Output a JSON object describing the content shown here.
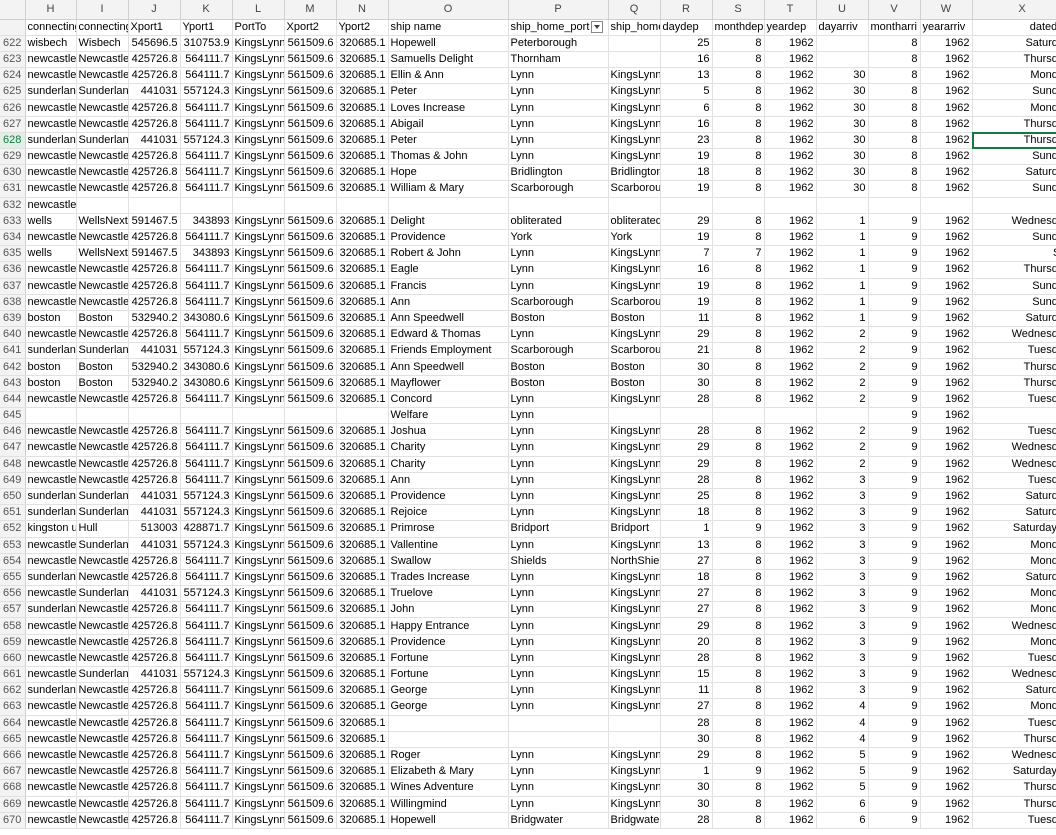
{
  "columns": [
    "H",
    "I",
    "J",
    "K",
    "L",
    "M",
    "N",
    "O",
    "P",
    "Q",
    "R",
    "S",
    "T",
    "U",
    "V",
    "W",
    "X"
  ],
  "selected_row": "628",
  "rows": [
    {
      "n": "",
      "c": [
        "connecting",
        "connecting",
        "Xport1",
        "Yport1",
        "PortTo",
        "Xport2",
        "Yport2",
        "ship name",
        "ship_home_port",
        "ship_home",
        "daydep",
        "monthdep",
        "yeardep",
        "dayarriv",
        "montharri",
        "yeararriv",
        "datedep"
      ],
      "h": true
    },
    {
      "n": "622",
      "c": [
        "wisbech",
        "Wisbech",
        "545696.5",
        "310753.9",
        "KingsLynn",
        "561509.6",
        "320685.1",
        "Hopewell",
        "Peterborough",
        "",
        "25",
        "8",
        "1962",
        "",
        "8",
        "1962",
        "Saturday"
      ]
    },
    {
      "n": "623",
      "c": [
        "newcastle",
        "Newcastle",
        "425726.8",
        "564111.7",
        "KingsLynn",
        "561509.6",
        "320685.1",
        "Samuells Delight",
        "Thornham",
        "",
        "16",
        "8",
        "1962",
        "",
        "8",
        "1962",
        "Thursday"
      ]
    },
    {
      "n": "624",
      "c": [
        "newcastle",
        "Newcastle",
        "425726.8",
        "564111.7",
        "KingsLynn",
        "561509.6",
        "320685.1",
        "Ellin & Ann",
        "Lynn",
        "KingsLynn",
        "13",
        "8",
        "1962",
        "30",
        "8",
        "1962",
        "Monday"
      ]
    },
    {
      "n": "625",
      "c": [
        "sunderland",
        "Sunderlan",
        "441031",
        "557124.3",
        "KingsLynn",
        "561509.6",
        "320685.1",
        "Peter",
        "Lynn",
        "KingsLynn",
        "5",
        "8",
        "1962",
        "30",
        "8",
        "1962",
        "Sunday"
      ]
    },
    {
      "n": "626",
      "c": [
        "newcastle",
        "Newcastle",
        "425726.8",
        "564111.7",
        "KingsLynn",
        "561509.6",
        "320685.1",
        "Loves Increase",
        "Lynn",
        "KingsLynn",
        "6",
        "8",
        "1962",
        "30",
        "8",
        "1962",
        "Monday"
      ]
    },
    {
      "n": "627",
      "c": [
        "newcastle",
        "Newcastle",
        "425726.8",
        "564111.7",
        "KingsLynn",
        "561509.6",
        "320685.1",
        "Abigail",
        "Lynn",
        "KingsLynn",
        "16",
        "8",
        "1962",
        "30",
        "8",
        "1962",
        "Thursday"
      ]
    },
    {
      "n": "628",
      "c": [
        "sunderland",
        "Sunderlan",
        "441031",
        "557124.3",
        "KingsLynn",
        "561509.6",
        "320685.1",
        "Peter",
        "Lynn",
        "KingsLynn",
        "23",
        "8",
        "1962",
        "30",
        "8",
        "1962",
        "Thursday"
      ],
      "sel": true
    },
    {
      "n": "629",
      "c": [
        "newcastle",
        "Newcastle",
        "425726.8",
        "564111.7",
        "KingsLynn",
        "561509.6",
        "320685.1",
        "Thomas & John",
        "Lynn",
        "KingsLynn",
        "19",
        "8",
        "1962",
        "30",
        "8",
        "1962",
        "Sunday"
      ]
    },
    {
      "n": "630",
      "c": [
        "newcastle",
        "Newcastle",
        "425726.8",
        "564111.7",
        "KingsLynn",
        "561509.6",
        "320685.1",
        "Hope",
        "Bridlington",
        "Bridlington",
        "18",
        "8",
        "1962",
        "30",
        "8",
        "1962",
        "Saturday"
      ]
    },
    {
      "n": "631",
      "c": [
        "newcastle",
        "Newcastle",
        "425726.8",
        "564111.7",
        "KingsLynn",
        "561509.6",
        "320685.1",
        "William & Mary",
        "Scarborough",
        "Scarborou",
        "19",
        "8",
        "1962",
        "30",
        "8",
        "1962",
        "Sunday"
      ]
    },
    {
      "n": "632",
      "c": [
        "newcastle",
        "",
        "",
        "",
        "",
        "",
        "",
        "",
        "",
        "",
        "",
        "",
        "",
        "",
        "",
        "",
        ""
      ]
    },
    {
      "n": "633",
      "c": [
        "wells",
        "WellsNext",
        "591467.5",
        "343893",
        "KingsLynn",
        "561509.6",
        "320685.1",
        "Delight",
        "obliterated",
        "obliterated",
        "29",
        "8",
        "1962",
        "1",
        "9",
        "1962",
        "Wednesday"
      ]
    },
    {
      "n": "634",
      "c": [
        "newcastle",
        "Newcastle",
        "425726.8",
        "564111.7",
        "KingsLynn",
        "561509.6",
        "320685.1",
        "Providence",
        "York",
        "York",
        "19",
        "8",
        "1962",
        "1",
        "9",
        "1962",
        "Sunday"
      ]
    },
    {
      "n": "635",
      "c": [
        "wells",
        "WellsNext",
        "591467.5",
        "343893",
        "KingsLynn",
        "561509.6",
        "320685.1",
        "Robert & John",
        "Lynn",
        "KingsLynn",
        "7",
        "7",
        "1962",
        "1",
        "9",
        "1962",
        "Sat"
      ]
    },
    {
      "n": "636",
      "c": [
        "newcastle",
        "Newcastle",
        "425726.8",
        "564111.7",
        "KingsLynn",
        "561509.6",
        "320685.1",
        "Eagle",
        "Lynn",
        "KingsLynn",
        "16",
        "8",
        "1962",
        "1",
        "9",
        "1962",
        "Thursday"
      ]
    },
    {
      "n": "637",
      "c": [
        "newcastle",
        "Newcastle",
        "425726.8",
        "564111.7",
        "KingsLynn",
        "561509.6",
        "320685.1",
        "Francis",
        "Lynn",
        "KingsLynn",
        "19",
        "8",
        "1962",
        "1",
        "9",
        "1962",
        "Sunday"
      ]
    },
    {
      "n": "638",
      "c": [
        "newcastle",
        "Newcastle",
        "425726.8",
        "564111.7",
        "KingsLynn",
        "561509.6",
        "320685.1",
        "Ann",
        "Scarborough",
        "Scarborou",
        "19",
        "8",
        "1962",
        "1",
        "9",
        "1962",
        "Sunday"
      ]
    },
    {
      "n": "639",
      "c": [
        "boston",
        "Boston",
        "532940.2",
        "343080.6",
        "KingsLynn",
        "561509.6",
        "320685.1",
        "Ann Speedwell",
        "Boston",
        "Boston",
        "11",
        "8",
        "1962",
        "1",
        "9",
        "1962",
        "Saturday"
      ]
    },
    {
      "n": "640",
      "c": [
        "newcastle",
        "Newcastle",
        "425726.8",
        "564111.7",
        "KingsLynn",
        "561509.6",
        "320685.1",
        "Edward & Thomas",
        "Lynn",
        "KingsLynn",
        "29",
        "8",
        "1962",
        "2",
        "9",
        "1962",
        "Wednesday"
      ]
    },
    {
      "n": "641",
      "c": [
        "sunderland",
        "Sunderlan",
        "441031",
        "557124.3",
        "KingsLynn",
        "561509.6",
        "320685.1",
        "Friends Employment",
        "Scarborough",
        "Scarborou",
        "21",
        "8",
        "1962",
        "2",
        "9",
        "1962",
        "Tuesday"
      ]
    },
    {
      "n": "642",
      "c": [
        "boston",
        "Boston",
        "532940.2",
        "343080.6",
        "KingsLynn",
        "561509.6",
        "320685.1",
        "Ann Speedwell",
        "Boston",
        "Boston",
        "30",
        "8",
        "1962",
        "2",
        "9",
        "1962",
        "Thursday"
      ]
    },
    {
      "n": "643",
      "c": [
        "boston",
        "Boston",
        "532940.2",
        "343080.6",
        "KingsLynn",
        "561509.6",
        "320685.1",
        "Mayflower",
        "Boston",
        "Boston",
        "30",
        "8",
        "1962",
        "2",
        "9",
        "1962",
        "Thursday"
      ]
    },
    {
      "n": "644",
      "c": [
        "newcastle",
        "Newcastle",
        "425726.8",
        "564111.7",
        "KingsLynn",
        "561509.6",
        "320685.1",
        "Concord",
        "Lynn",
        "KingsLynn",
        "28",
        "8",
        "1962",
        "2",
        "9",
        "1962",
        "Tuesday"
      ]
    },
    {
      "n": "645",
      "c": [
        "",
        "",
        "",
        "",
        "",
        "",
        "",
        "Welfare",
        "Lynn",
        "",
        "",
        "",
        "",
        "",
        "9",
        "1962",
        ""
      ]
    },
    {
      "n": "646",
      "c": [
        "newcastle",
        "Newcastle",
        "425726.8",
        "564111.7",
        "KingsLynn",
        "561509.6",
        "320685.1",
        "Joshua",
        "Lynn",
        "KingsLynn",
        "28",
        "8",
        "1962",
        "2",
        "9",
        "1962",
        "Tuesday"
      ]
    },
    {
      "n": "647",
      "c": [
        "newcastle",
        "Newcastle",
        "425726.8",
        "564111.7",
        "KingsLynn",
        "561509.6",
        "320685.1",
        "Charity",
        "Lynn",
        "KingsLynn",
        "29",
        "8",
        "1962",
        "2",
        "9",
        "1962",
        "Wednesday"
      ]
    },
    {
      "n": "648",
      "c": [
        "newcastle",
        "Newcastle",
        "425726.8",
        "564111.7",
        "KingsLynn",
        "561509.6",
        "320685.1",
        "Charity",
        "Lynn",
        "KingsLynn",
        "29",
        "8",
        "1962",
        "2",
        "9",
        "1962",
        "Wednesday"
      ]
    },
    {
      "n": "649",
      "c": [
        "newcastle",
        "Newcastle",
        "425726.8",
        "564111.7",
        "KingsLynn",
        "561509.6",
        "320685.1",
        "Ann",
        "Lynn",
        "KingsLynn",
        "28",
        "8",
        "1962",
        "3",
        "9",
        "1962",
        "Tuesday"
      ]
    },
    {
      "n": "650",
      "c": [
        "sunderland",
        "Sunderlan",
        "441031",
        "557124.3",
        "KingsLynn",
        "561509.6",
        "320685.1",
        "Providence",
        "Lynn",
        "KingsLynn",
        "25",
        "8",
        "1962",
        "3",
        "9",
        "1962",
        "Saturday"
      ]
    },
    {
      "n": "651",
      "c": [
        "sunderland",
        "Sunderlan",
        "441031",
        "557124.3",
        "KingsLynn",
        "561509.6",
        "320685.1",
        "Rejoice",
        "Lynn",
        "KingsLynn",
        "18",
        "8",
        "1962",
        "3",
        "9",
        "1962",
        "Saturday"
      ]
    },
    {
      "n": "652",
      "c": [
        "kingston u",
        "Hull",
        "513003",
        "428871.7",
        "KingsLynn",
        "561509.6",
        "320685.1",
        "Primrose",
        "Bridport",
        "Bridport",
        "1",
        "9",
        "1962",
        "3",
        "9",
        "1962",
        "Saturday, S"
      ]
    },
    {
      "n": "653",
      "c": [
        "newcastle",
        "Sunderlan",
        "441031",
        "557124.3",
        "KingsLynn",
        "561509.6",
        "320685.1",
        "Vallentine",
        "Lynn",
        "KingsLynn",
        "13",
        "8",
        "1962",
        "3",
        "9",
        "1962",
        "Monday"
      ]
    },
    {
      "n": "654",
      "c": [
        "newcastle",
        "Newcastle",
        "425726.8",
        "564111.7",
        "KingsLynn",
        "561509.6",
        "320685.1",
        "Swallow",
        "Shields",
        "NorthShie",
        "27",
        "8",
        "1962",
        "3",
        "9",
        "1962",
        "Monday"
      ]
    },
    {
      "n": "655",
      "c": [
        "sunderland",
        "Newcastle",
        "425726.8",
        "564111.7",
        "KingsLynn",
        "561509.6",
        "320685.1",
        "Trades Increase",
        "Lynn",
        "KingsLynn",
        "18",
        "8",
        "1962",
        "3",
        "9",
        "1962",
        "Saturday"
      ]
    },
    {
      "n": "656",
      "c": [
        "newcastle",
        "Sunderlan",
        "441031",
        "557124.3",
        "KingsLynn",
        "561509.6",
        "320685.1",
        "Truelove",
        "Lynn",
        "KingsLynn",
        "27",
        "8",
        "1962",
        "3",
        "9",
        "1962",
        "Monday"
      ]
    },
    {
      "n": "657",
      "c": [
        "sunderland",
        "Newcastle",
        "425726.8",
        "564111.7",
        "KingsLynn",
        "561509.6",
        "320685.1",
        "John",
        "Lynn",
        "KingsLynn",
        "27",
        "8",
        "1962",
        "3",
        "9",
        "1962",
        "Monday"
      ]
    },
    {
      "n": "658",
      "c": [
        "newcastle",
        "Newcastle",
        "425726.8",
        "564111.7",
        "KingsLynn",
        "561509.6",
        "320685.1",
        "Happy Entrance",
        "Lynn",
        "KingsLynn",
        "29",
        "8",
        "1962",
        "3",
        "9",
        "1962",
        "Wednesday"
      ]
    },
    {
      "n": "659",
      "c": [
        "newcastle",
        "Newcastle",
        "425726.8",
        "564111.7",
        "KingsLynn",
        "561509.6",
        "320685.1",
        "Providence",
        "Lynn",
        "KingsLynn",
        "20",
        "8",
        "1962",
        "3",
        "9",
        "1962",
        "Monday"
      ]
    },
    {
      "n": "660",
      "c": [
        "newcastle",
        "Newcastle",
        "425726.8",
        "564111.7",
        "KingsLynn",
        "561509.6",
        "320685.1",
        "Fortune",
        "Lynn",
        "KingsLynn",
        "28",
        "8",
        "1962",
        "3",
        "9",
        "1962",
        "Tuesday"
      ]
    },
    {
      "n": "661",
      "c": [
        "newcastle",
        "Sunderlan",
        "441031",
        "557124.3",
        "KingsLynn",
        "561509.6",
        "320685.1",
        "Fortune",
        "Lynn",
        "KingsLynn",
        "15",
        "8",
        "1962",
        "3",
        "9",
        "1962",
        "Wednesday"
      ]
    },
    {
      "n": "662",
      "c": [
        "sunderland",
        "Newcastle",
        "425726.8",
        "564111.7",
        "KingsLynn",
        "561509.6",
        "320685.1",
        "George",
        "Lynn",
        "KingsLynn",
        "11",
        "8",
        "1962",
        "3",
        "9",
        "1962",
        "Saturday"
      ]
    },
    {
      "n": "663",
      "c": [
        "newcastle",
        "Newcastle",
        "425726.8",
        "564111.7",
        "KingsLynn",
        "561509.6",
        "320685.1",
        "George",
        "Lynn",
        "KingsLynn",
        "27",
        "8",
        "1962",
        "4",
        "9",
        "1962",
        "Monday"
      ]
    },
    {
      "n": "664",
      "c": [
        "newcastle",
        "Newcastle",
        "425726.8",
        "564111.7",
        "KingsLynn",
        "561509.6",
        "320685.1",
        "",
        "",
        "",
        "28",
        "8",
        "1962",
        "4",
        "9",
        "1962",
        "Tuesday"
      ]
    },
    {
      "n": "665",
      "c": [
        "newcastle",
        "Newcastle",
        "425726.8",
        "564111.7",
        "KingsLynn",
        "561509.6",
        "320685.1",
        "",
        "",
        "",
        "30",
        "8",
        "1962",
        "4",
        "9",
        "1962",
        "Thursday"
      ]
    },
    {
      "n": "666",
      "c": [
        "newcastle",
        "Newcastle",
        "425726.8",
        "564111.7",
        "KingsLynn",
        "561509.6",
        "320685.1",
        "Roger",
        "Lynn",
        "KingsLynn",
        "29",
        "8",
        "1962",
        "5",
        "9",
        "1962",
        "Wednesday"
      ]
    },
    {
      "n": "667",
      "c": [
        "newcastle",
        "Newcastle",
        "425726.8",
        "564111.7",
        "KingsLynn",
        "561509.6",
        "320685.1",
        "Elizabeth & Mary",
        "Lynn",
        "KingsLynn",
        "1",
        "9",
        "1962",
        "5",
        "9",
        "1962",
        "Saturday, S"
      ]
    },
    {
      "n": "668",
      "c": [
        "newcastle",
        "Newcastle",
        "425726.8",
        "564111.7",
        "KingsLynn",
        "561509.6",
        "320685.1",
        "Wines Adventure",
        "Lynn",
        "KingsLynn",
        "30",
        "8",
        "1962",
        "5",
        "9",
        "1962",
        "Thursday"
      ]
    },
    {
      "n": "669",
      "c": [
        "newcastle",
        "Newcastle",
        "425726.8",
        "564111.7",
        "KingsLynn",
        "561509.6",
        "320685.1",
        "Willingmind",
        "Lynn",
        "KingsLynn",
        "30",
        "8",
        "1962",
        "6",
        "9",
        "1962",
        "Thursday"
      ]
    },
    {
      "n": "670",
      "c": [
        "newcastle",
        "Newcastle",
        "425726.8",
        "564111.7",
        "KingsLynn",
        "561509.6",
        "320685.1",
        "Hopewell",
        "Bridgwater",
        "Bridgwate",
        "28",
        "8",
        "1962",
        "6",
        "9",
        "1962",
        "Tuesday"
      ]
    }
  ]
}
